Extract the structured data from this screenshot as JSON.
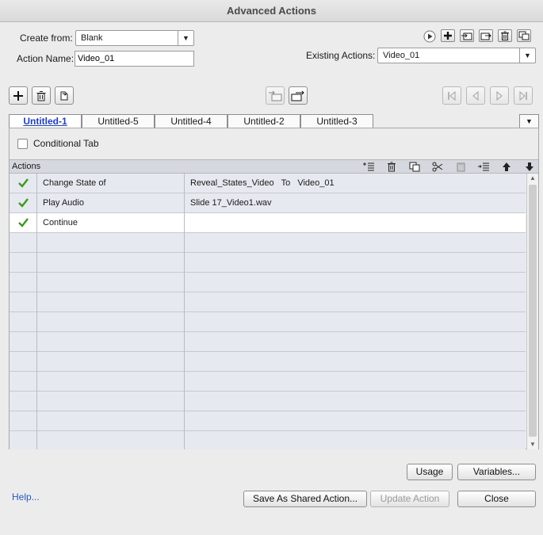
{
  "window": {
    "title": "Advanced Actions"
  },
  "form": {
    "create_from_label": "Create from:",
    "create_from_value": "Blank",
    "action_name_label": "Action Name:",
    "action_name_value": "Video_01",
    "existing_actions_label": "Existing Actions:",
    "existing_actions_value": "Video_01"
  },
  "tabs": [
    {
      "label": "Untitled-1",
      "active": true
    },
    {
      "label": "Untitled-5",
      "active": false
    },
    {
      "label": "Untitled-4",
      "active": false
    },
    {
      "label": "Untitled-2",
      "active": false
    },
    {
      "label": "Untitled-3",
      "active": false
    }
  ],
  "conditional_tab": {
    "label": "Conditional Tab",
    "checked": false
  },
  "actions_table": {
    "header": "Actions",
    "rows": [
      {
        "status": "check-icon",
        "action": "Change State of",
        "target": "Reveal_States_Video   To   Video_01"
      },
      {
        "status": "check-icon",
        "action": "Play Audio",
        "target": "Slide 17_Video1.wav"
      },
      {
        "status": "check-icon",
        "action": "Continue",
        "target": ""
      }
    ]
  },
  "buttons": {
    "usage": "Usage",
    "variables": "Variables...",
    "save_shared": "Save As Shared Action...",
    "update_action": "Update Action",
    "close": "Close",
    "help": "Help..."
  },
  "colors": {
    "check": "#3a9a1a",
    "link": "#2a5bbf",
    "active_tab": "#1f3fbf"
  }
}
